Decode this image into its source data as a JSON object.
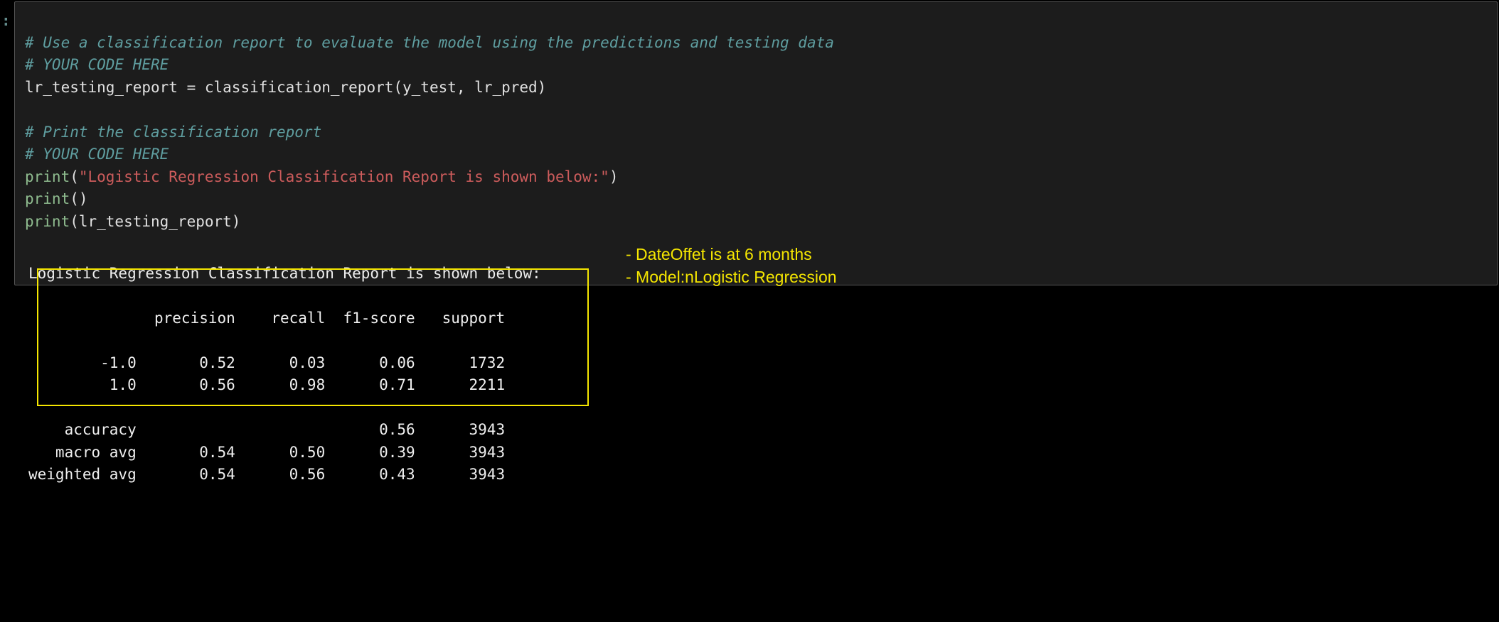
{
  "chart_data": {
    "type": "table",
    "title": "Logistic Regression Classification Report is shown below:",
    "columns": [
      "precision",
      "recall",
      "f1-score",
      "support"
    ],
    "rows": [
      {
        "label": "-1.0",
        "precision": 0.52,
        "recall": 0.03,
        "f1_score": 0.06,
        "support": 1732
      },
      {
        "label": "1.0",
        "precision": 0.56,
        "recall": 0.98,
        "f1_score": 0.71,
        "support": 2211
      },
      {
        "label": "accuracy",
        "precision": null,
        "recall": null,
        "f1_score": 0.56,
        "support": 3943
      },
      {
        "label": "macro avg",
        "precision": 0.54,
        "recall": 0.5,
        "f1_score": 0.39,
        "support": 3943
      },
      {
        "label": "weighted avg",
        "precision": 0.54,
        "recall": 0.56,
        "f1_score": 0.43,
        "support": 3943
      }
    ]
  },
  "prompt_marker": ":",
  "code": {
    "comment1": "# Use a classification report to evaluate the model using the predictions and testing data",
    "comment2": "# YOUR CODE HERE",
    "lhs1": "lr_testing_report ",
    "eq": "=",
    "rhs1": " classification_report(y_test, lr_pred)",
    "comment3": "# Print the classification report",
    "comment4": "# YOUR CODE HERE",
    "print_kw1": "print",
    "paren_open": "(",
    "first_print_str": "\"Logistic Regression Classification Report is shown below:\"",
    "paren_close": ")",
    "print_kw2": "print",
    "empty_parens": "()",
    "print_kw3": "print",
    "third_print_arg": "(lr_testing_report)"
  },
  "output": {
    "heading": "Logistic Regression Classification Report is shown below:",
    "header_line": "              precision    recall  f1-score   support",
    "row_neg1": "        -1.0       0.52      0.03      0.06      1732",
    "row_pos1": "         1.0       0.56      0.98      0.71      2211",
    "row_acc": "    accuracy                           0.56      3943",
    "row_macro": "   macro avg       0.54      0.50      0.39      3943",
    "row_wavg": "weighted avg       0.54      0.56      0.43      3943"
  },
  "annotations": {
    "line1": "- DateOffet is at 6 months",
    "line2": "- Model:nLogistic Regression"
  }
}
